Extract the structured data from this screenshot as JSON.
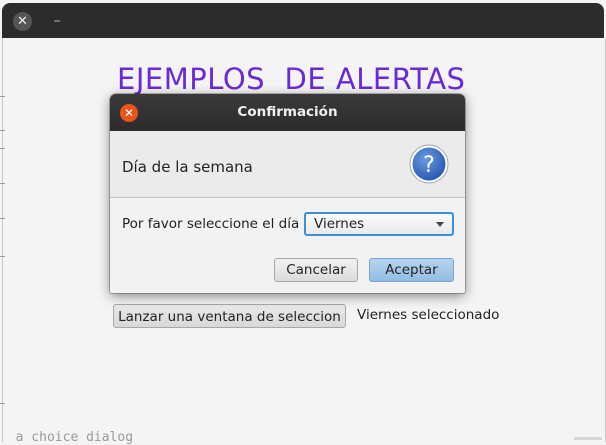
{
  "main_window": {
    "close_glyph": "✕",
    "minimize_glyph": "–",
    "heading": "EJEMPLOS  DE ALERTAS",
    "launch_button": "Lanzar una ventana de seleccion",
    "result_label": "Viernes seleccionado",
    "bottom_text": "  a choice dialog"
  },
  "dialog": {
    "title": "Confirmación",
    "close_glyph": "✕",
    "header_text": "Día de la semana",
    "icon": "question-icon",
    "content_label": "Por favor seleccione el día",
    "choice_value": "Viernes",
    "cancel_label": "Cancelar",
    "accept_label": "Aceptar"
  },
  "colors": {
    "heading": "#6a2bd6",
    "titlebar": "#2c2c2c",
    "close_button": "#e9541c",
    "accept_button": "#92bde4",
    "focus_ring": "#3f8fd6",
    "question_icon": "#3b6fc4"
  }
}
